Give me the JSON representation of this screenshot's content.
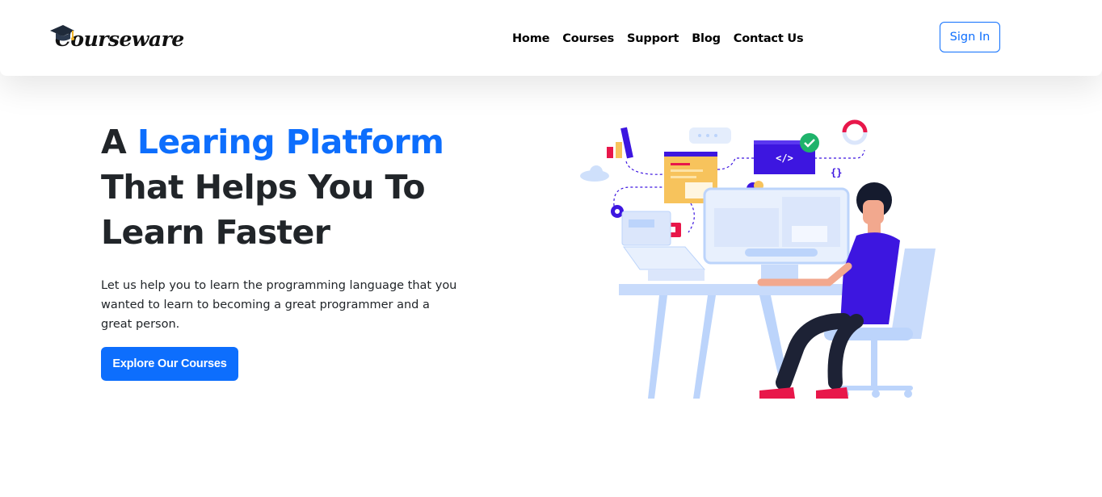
{
  "brand": {
    "name": "Courseware",
    "logo_icon": "graduation-cap-icon"
  },
  "nav": {
    "links": [
      {
        "label": "Home"
      },
      {
        "label": "Courses"
      },
      {
        "label": "Support"
      },
      {
        "label": "Blog"
      },
      {
        "label": "Contact Us"
      }
    ],
    "signin_label": "Sign In"
  },
  "hero": {
    "title_prefix": "A ",
    "title_accent": "Learing Platform",
    "title_rest": "That Helps You To Learn Faster",
    "description": "Let us help you to learn the programming language that you wanted to learn to becoming a great programmer and a great person.",
    "cta_label": "Explore Our Courses",
    "illustration_icon": "developer-at-desk-illustration",
    "code_glyph": "</>",
    "braces_glyph": "{}"
  },
  "colors": {
    "primary": "#0d6efd",
    "dark_text": "#212529",
    "illustration_purple": "#3d16e0",
    "illustration_pink": "#e8174a",
    "illustration_light_blue": "#bcd4fb"
  }
}
